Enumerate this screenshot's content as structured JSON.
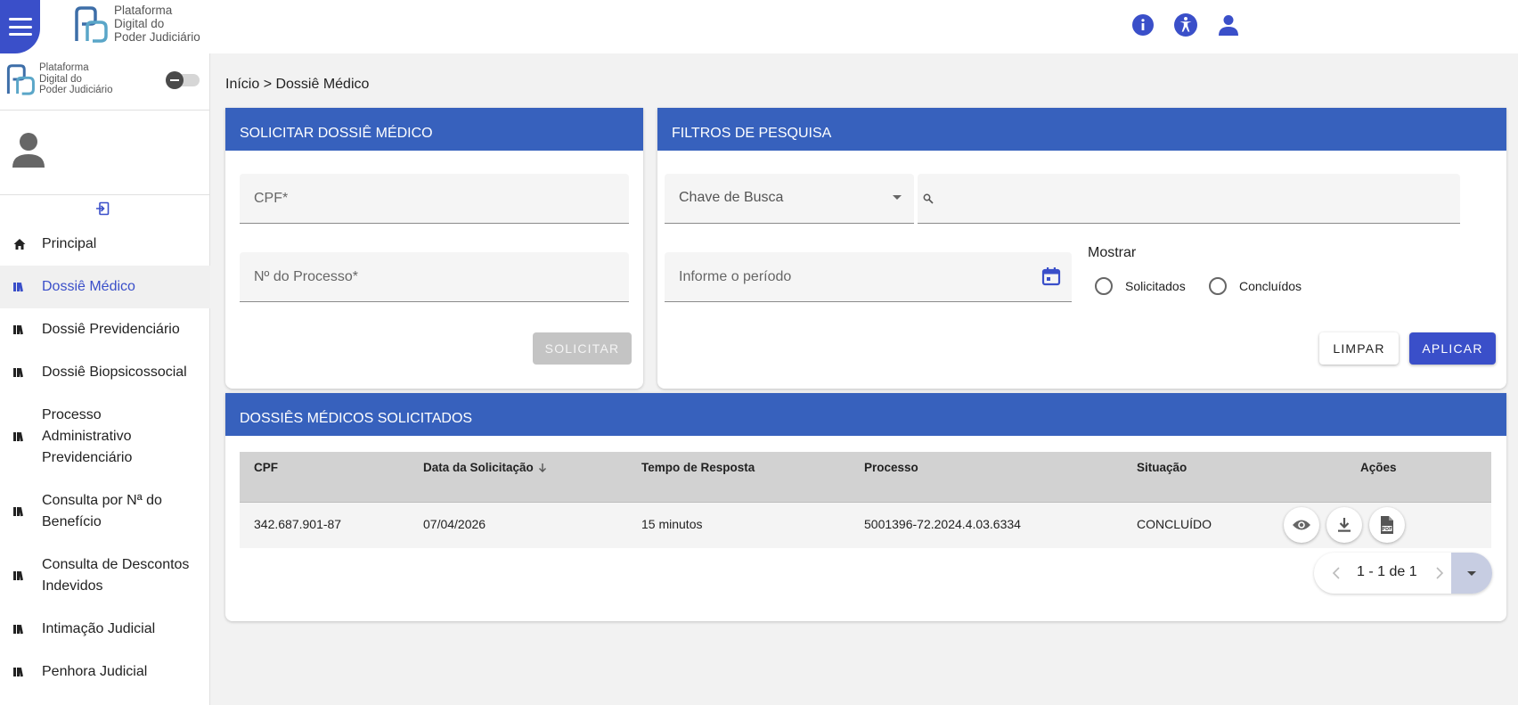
{
  "app": {
    "brand_lines": [
      "Plataforma",
      "Digital do",
      "Poder Judiciário"
    ],
    "accent_color": "#3a4fc9",
    "header_color": "#3761bd"
  },
  "sidebar": {
    "items": [
      {
        "label": "Principal",
        "icon": "home-icon",
        "active": false
      },
      {
        "label": "Dossiê Médico",
        "icon": "dossier-icon",
        "active": true
      },
      {
        "label": "Dossiê Previdenciário",
        "icon": "dossier-icon",
        "active": false
      },
      {
        "label": "Dossiê Biopsicossocial",
        "icon": "dossier-icon",
        "active": false
      },
      {
        "label": "Processo Administrativo Previdenciário",
        "icon": "dossier-icon",
        "active": false
      },
      {
        "label": "Consulta por Nª do Benefício",
        "icon": "dossier-icon",
        "active": false
      },
      {
        "label": "Consulta de Descontos Indevidos",
        "icon": "dossier-icon",
        "active": false
      },
      {
        "label": "Intimação Judicial",
        "icon": "dossier-icon",
        "active": false
      },
      {
        "label": "Penhora Judicial",
        "icon": "dossier-icon",
        "active": false
      }
    ]
  },
  "breadcrumb": "Início > Dossiê Médico",
  "request_panel": {
    "title": "SOLICITAR DOSSIÊ MÉDICO",
    "cpf_placeholder": "CPF*",
    "process_placeholder": "Nº do Processo*",
    "submit_label": "SOLICITAR"
  },
  "filter_panel": {
    "title": "FILTROS DE PESQUISA",
    "search_key_label": "Chave de Busca",
    "period_placeholder": "Informe o período",
    "show_label": "Mostrar",
    "radio_requested": "Solicitados",
    "radio_completed": "Concluídos",
    "clear_label": "LIMPAR",
    "apply_label": "APLICAR"
  },
  "results_panel": {
    "title": "DOSSIÊS MÉDICOS SOLICITADOS",
    "columns": [
      "CPF",
      "Data da Solicitação",
      "Tempo de Resposta",
      "Processo",
      "Situação",
      "Ações"
    ],
    "rows": [
      {
        "cpf": "342.687.901-87",
        "date": "07/04/2026",
        "response_time": "15 minutos",
        "process": "5001396-72.2024.4.03.6334",
        "status": "CONCLUÍDO"
      }
    ],
    "pagination": "1 - 1 de 1"
  }
}
